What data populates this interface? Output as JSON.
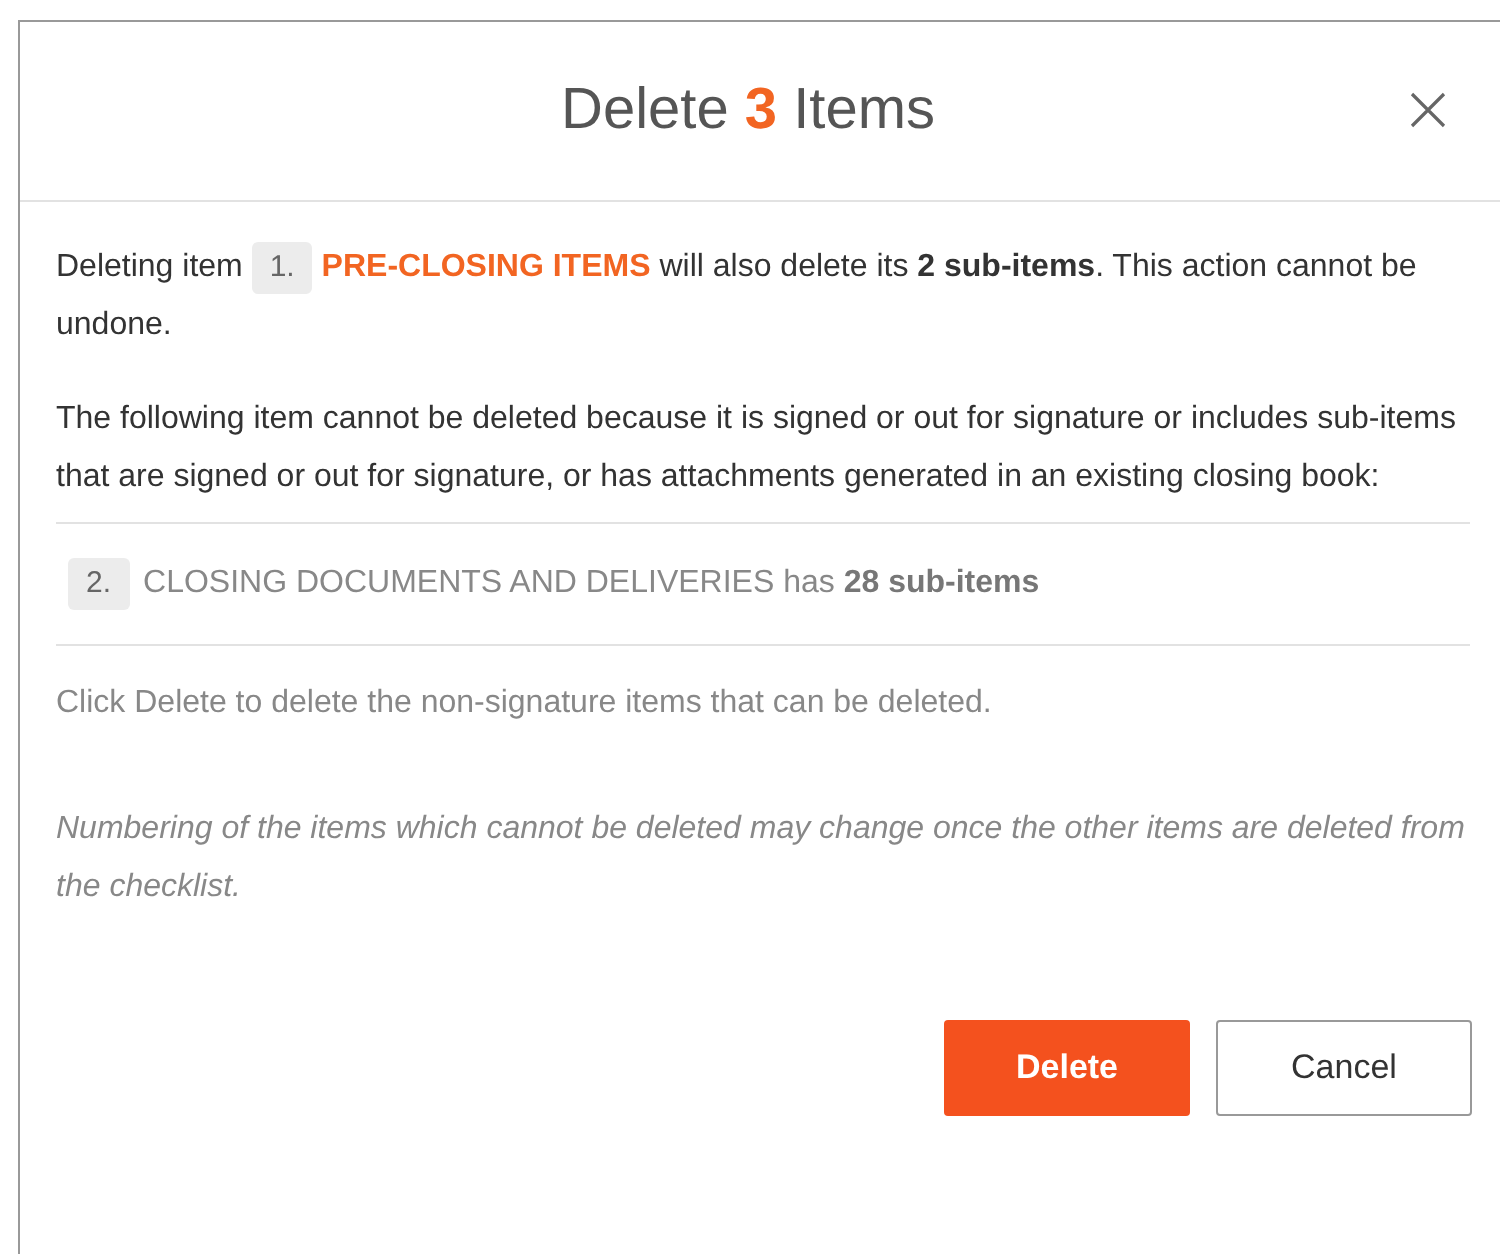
{
  "dialog": {
    "title": "Delete **3** Items",
    "deletable_item": {
      "lead": "Deleting item",
      "number": "1.",
      "name": "PRE-CLOSING ITEMS",
      "rest": "will also delete its **2 sub-items**. This action cannot be undone."
    },
    "blocked_notice": "The following item cannot be deleted because it is signed or out for signature or includes sub-items that are signed or out for signature, or has attachments generated in an existing closing book:",
    "blocked_items": [
      {
        "number": "2.",
        "text": "CLOSING DOCUMENTS AND DELIVERIES has **28 sub-items**"
      }
    ],
    "instruction": "Click Delete to delete the non-signature items that can be deleted.",
    "note": "Numbering of the items which cannot be deleted may change once the other items are deleted from the checklist.",
    "buttons": [
      {
        "label": "Delete",
        "kind": "primary"
      },
      {
        "label": "Cancel",
        "kind": "secondary"
      }
    ]
  }
}
